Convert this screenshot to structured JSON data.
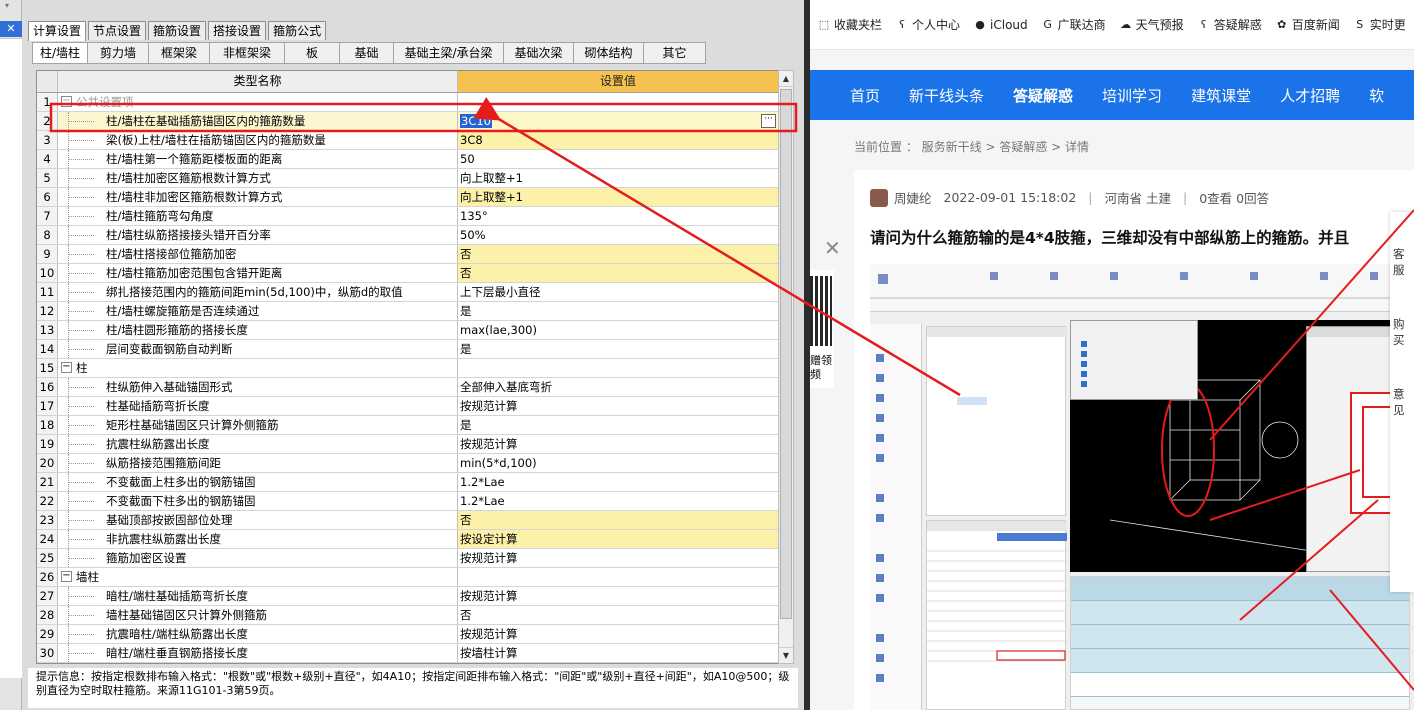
{
  "left_window": {
    "close_symbol": "✕",
    "main_tabs": [
      "计算设置",
      "节点设置",
      "箍筋设置",
      "搭接设置",
      "箍筋公式"
    ],
    "active_main_tab": 0,
    "sub_tabs": [
      "柱/墙柱",
      "剪力墙",
      "框架梁",
      "非框架梁",
      "板",
      "基础",
      "基础主梁/承台梁",
      "基础次梁",
      "砌体结构",
      "其它"
    ],
    "active_sub_tab": 0,
    "grid": {
      "col_name": "类型名称",
      "col_value": "设置值",
      "rows": [
        {
          "num": "1",
          "name": "公共设置项",
          "value": "",
          "group": true,
          "toggle": "−",
          "faded": true
        },
        {
          "num": "2",
          "name": "柱/墙柱在基础插筋锚固区内的箍筋数量",
          "value": "3C10",
          "selected": true
        },
        {
          "num": "3",
          "name": "梁(板)上柱/墙柱在插筋锚固区内的箍筋数量",
          "value": "3C8",
          "hl": true
        },
        {
          "num": "4",
          "name": "柱/墙柱第一个箍筋距楼板面的距离",
          "value": "50"
        },
        {
          "num": "5",
          "name": "柱/墙柱加密区箍筋根数计算方式",
          "value": "向上取整+1"
        },
        {
          "num": "6",
          "name": "柱/墙柱非加密区箍筋根数计算方式",
          "value": "向上取整+1",
          "hl": true
        },
        {
          "num": "7",
          "name": "柱/墙柱箍筋弯勾角度",
          "value": "135°"
        },
        {
          "num": "8",
          "name": "柱/墙柱纵筋搭接接头错开百分率",
          "value": "50%"
        },
        {
          "num": "9",
          "name": "柱/墙柱搭接部位箍筋加密",
          "value": "否",
          "hl": true
        },
        {
          "num": "10",
          "name": "柱/墙柱箍筋加密范围包含错开距离",
          "value": "否",
          "hl": true
        },
        {
          "num": "11",
          "name": "绑扎搭接范围内的箍筋间距min(5d,100)中，纵筋d的取值",
          "value": "上下层最小直径"
        },
        {
          "num": "12",
          "name": "柱/墙柱螺旋箍筋是否连续通过",
          "value": "是"
        },
        {
          "num": "13",
          "name": "柱/墙柱圆形箍筋的搭接长度",
          "value": "max(lae,300)"
        },
        {
          "num": "14",
          "name": "层间变截面钢筋自动判断",
          "value": "是"
        },
        {
          "num": "15",
          "name": "柱",
          "value": "",
          "group": true,
          "toggle": "−"
        },
        {
          "num": "16",
          "name": "柱纵筋伸入基础锚固形式",
          "value": "全部伸入基底弯折"
        },
        {
          "num": "17",
          "name": "柱基础插筋弯折长度",
          "value": "按规范计算"
        },
        {
          "num": "18",
          "name": "矩形柱基础锚固区只计算外侧箍筋",
          "value": "是"
        },
        {
          "num": "19",
          "name": "抗震柱纵筋露出长度",
          "value": "按规范计算"
        },
        {
          "num": "20",
          "name": "纵筋搭接范围箍筋间距",
          "value": "min(5*d,100)"
        },
        {
          "num": "21",
          "name": "不变截面上柱多出的钢筋锚固",
          "value": "1.2*Lae"
        },
        {
          "num": "22",
          "name": "不变截面下柱多出的钢筋锚固",
          "value": "1.2*Lae"
        },
        {
          "num": "23",
          "name": "基础顶部按嵌固部位处理",
          "value": "否",
          "hl": true
        },
        {
          "num": "24",
          "name": "非抗震柱纵筋露出长度",
          "value": "按设定计算",
          "hl": true
        },
        {
          "num": "25",
          "name": "箍筋加密区设置",
          "value": "按规范计算"
        },
        {
          "num": "26",
          "name": "墙柱",
          "value": "",
          "group": true,
          "toggle": "−"
        },
        {
          "num": "27",
          "name": "暗柱/端柱基础插筋弯折长度",
          "value": "按规范计算"
        },
        {
          "num": "28",
          "name": "墙柱基础锚固区只计算外侧箍筋",
          "value": "否"
        },
        {
          "num": "29",
          "name": "抗震暗柱/端柱纵筋露出长度",
          "value": "按规范计算"
        },
        {
          "num": "30",
          "name": "暗柱/端柱垂直钢筋搭接长度",
          "value": "按墙柱计算"
        }
      ]
    },
    "hint": "提示信息：按指定根数排布输入格式：\"根数\"或\"根数+级别+直径\"，如4A10；按指定间距排布输入格式：\"间距\"或\"级别+直径+间距\"，如A10@500；级别直径为空时取柱箍筋。来源11G101-3第59页。"
  },
  "browser": {
    "bookmarks": [
      {
        "icon": "bookmark-icon",
        "glyph": "⬚",
        "label": "收藏夹栏"
      },
      {
        "icon": "person-icon",
        "glyph": "ʕ",
        "label": "个人中心"
      },
      {
        "icon": "apple-icon",
        "glyph": "●",
        "label": "iCloud"
      },
      {
        "icon": "glodon-icon",
        "glyph": "G",
        "label": "广联达商"
      },
      {
        "icon": "weather-icon",
        "glyph": "☁",
        "label": "天气预报"
      },
      {
        "icon": "qa-icon",
        "glyph": "ʕ",
        "label": "答疑解惑"
      },
      {
        "icon": "baidu-icon",
        "glyph": "✿",
        "label": "百度新闻"
      },
      {
        "icon": "sougou-icon",
        "glyph": "S",
        "label": "实时更"
      }
    ],
    "nav": [
      "首页",
      "新干线头条",
      "答疑解惑",
      "培训学习",
      "建筑课堂",
      "人才招聘",
      "软"
    ],
    "active_nav": 2,
    "breadcrumb": "当前位置 ： 服务新干线 > 答疑解惑 > 详情",
    "post": {
      "author": "周婕纶",
      "date": "2022-09-01 15:18:02",
      "location": "河南省  土建",
      "views": "0查看  0回答",
      "title": "请问为什么箍筋输的是4*4肢箍，三维却没有中部纵筋上的箍筋。并且"
    },
    "side_qr_text": "赠领 频",
    "float_panel": [
      "客服",
      "购买",
      "意见"
    ],
    "close_symbol": "✕"
  },
  "colors": {
    "header_value_bg": "#f5c24f",
    "highlight_row": "#fbf1a9",
    "selection": "#2563d4",
    "nav_blue": "#1a73e8",
    "annotation_red": "#e51c1c"
  }
}
